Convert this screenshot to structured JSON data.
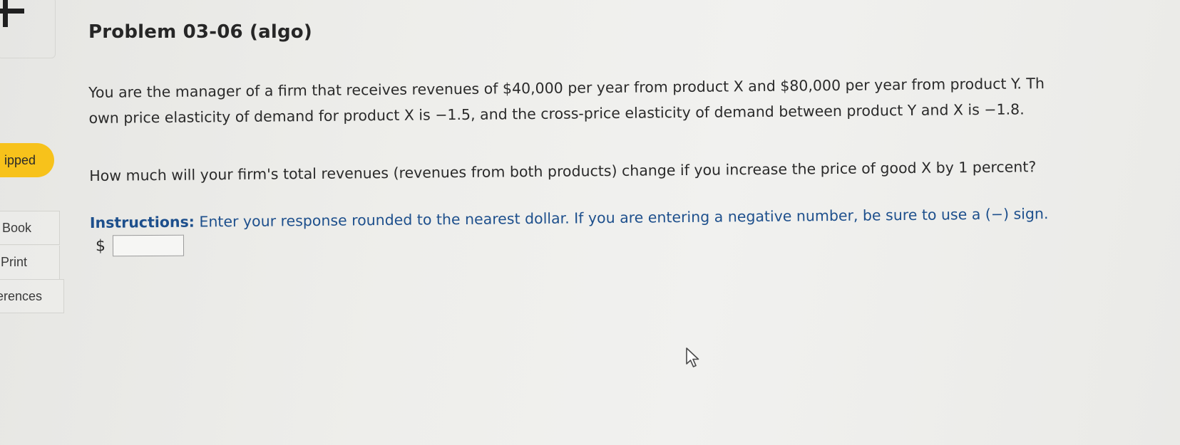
{
  "sidebar": {
    "status_label": "ipped",
    "book_label": "Book",
    "print_label": "Print",
    "references_label": "erences"
  },
  "problem": {
    "title": "Problem 03-06 (algo)",
    "line1": "You are the manager of a firm that receives revenues of $40,000 per year from product X and $80,000 per year from product Y. Th",
    "line2": "own price elasticity of demand for product X is −1.5, and the cross-price elasticity of demand between product Y and X is −1.8.",
    "question": "How much will your firm's total revenues (revenues from both products) change if you increase the price of good X by 1 percent?",
    "instructions_label": "Instructions:",
    "instructions_text": " Enter your response rounded to the nearest dollar. If you are entering a negative number, be sure to use a (−) sign."
  },
  "answer": {
    "currency": "$",
    "value": ""
  },
  "colors": {
    "status_pill": "#f7c21b",
    "instructions": "#1d4f8c",
    "background": "#eeeeeb"
  },
  "icons": {
    "add": "plus-icon",
    "pointer": "mouse-cursor-icon"
  }
}
